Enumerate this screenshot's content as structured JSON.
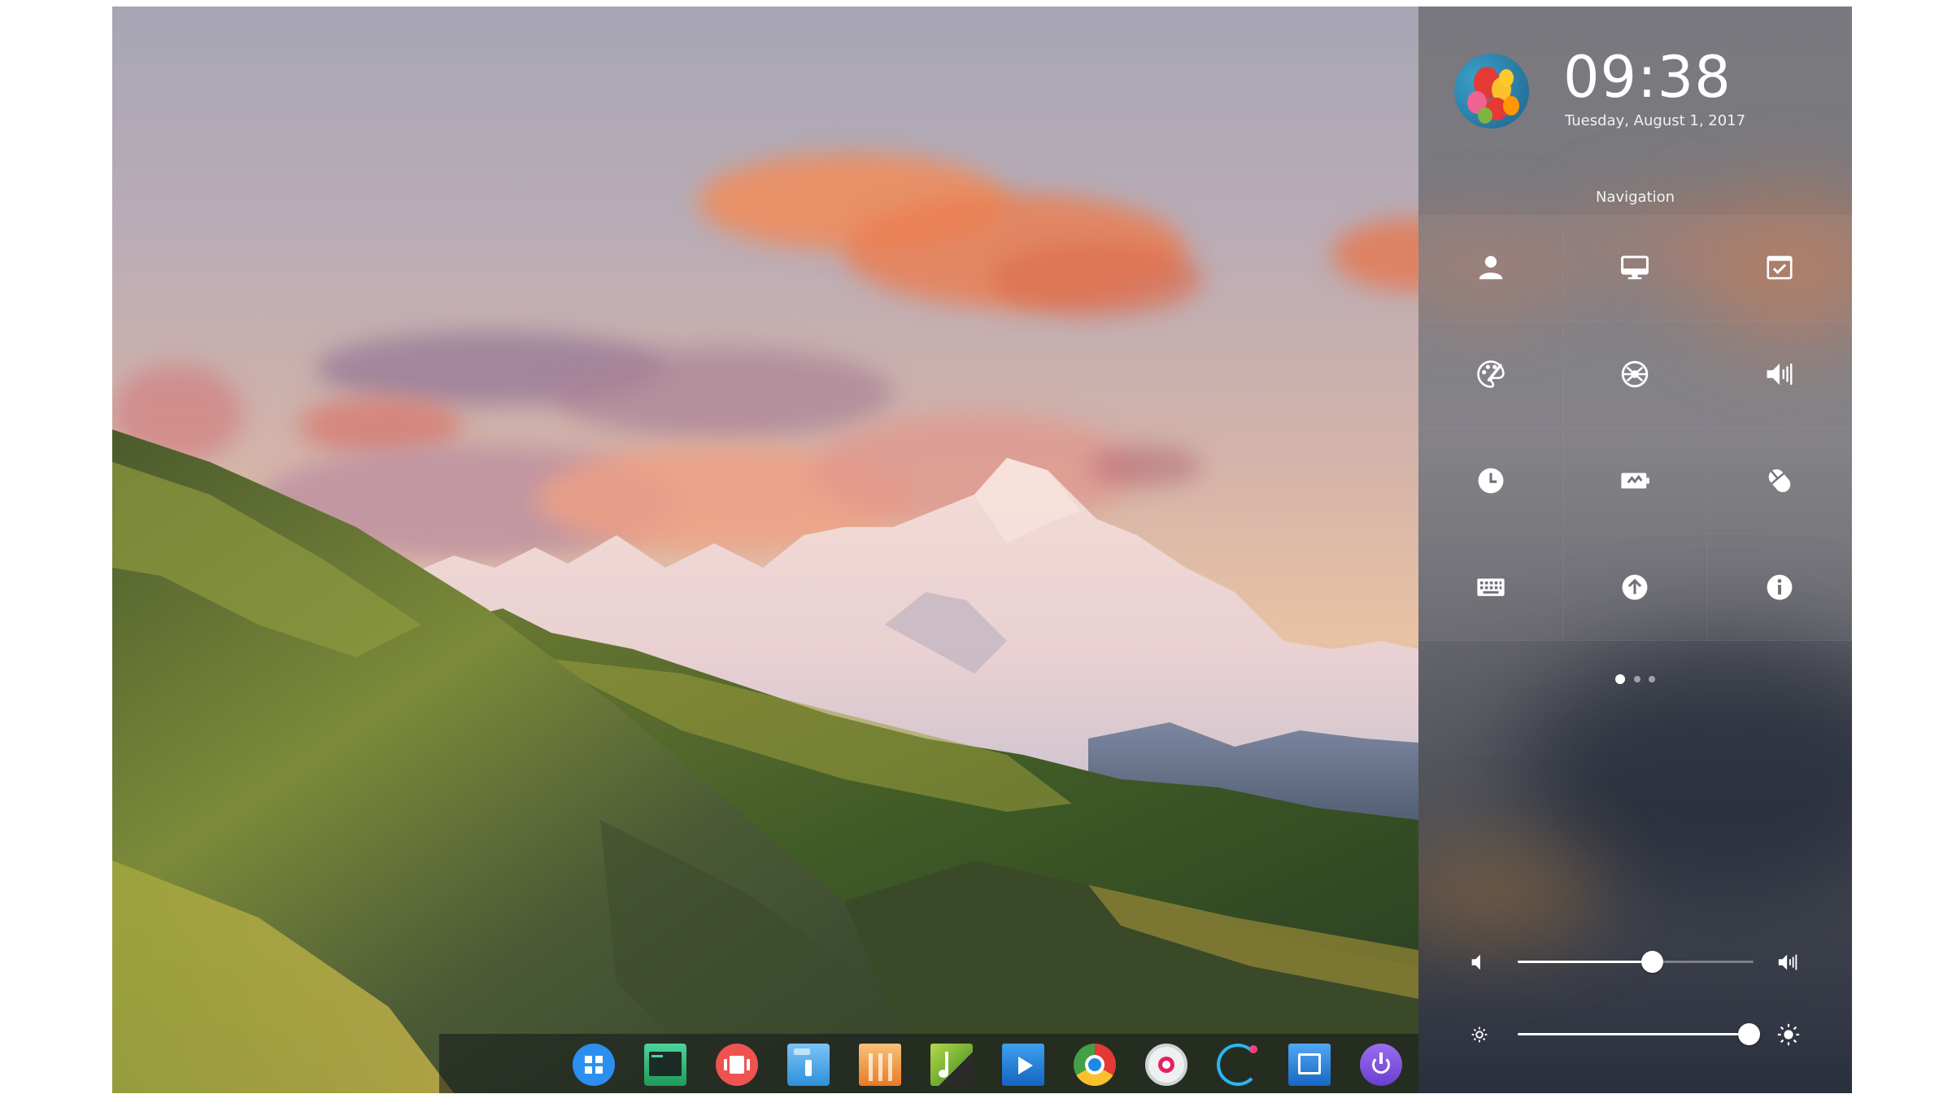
{
  "clock": {
    "time": "09:38",
    "date": "Tuesday, August 1, 2017"
  },
  "control_center": {
    "title": "Navigation",
    "tiles": [
      {
        "icon": "account-icon"
      },
      {
        "icon": "display-icon"
      },
      {
        "icon": "default-apps-icon"
      },
      {
        "icon": "personalization-icon"
      },
      {
        "icon": "network-icon"
      },
      {
        "icon": "sound-icon"
      },
      {
        "icon": "time-date-icon"
      },
      {
        "icon": "power-management-icon"
      },
      {
        "icon": "mouse-icon"
      },
      {
        "icon": "keyboard-icon"
      },
      {
        "icon": "update-icon"
      },
      {
        "icon": "system-info-icon"
      }
    ],
    "pager": {
      "pages": 3,
      "current": 1
    },
    "volume": {
      "level": 0.57
    },
    "brightness": {
      "level": 0.98
    }
  },
  "dock": {
    "apps": [
      {
        "name": "launcher-icon",
        "color": "#2b8ff0"
      },
      {
        "name": "terminal-icon",
        "color": "#2fbf71"
      },
      {
        "name": "multitasking-icon",
        "color": "#ef5350"
      },
      {
        "name": "file-manager-icon",
        "color": "#43a7f5"
      },
      {
        "name": "app-store-icon",
        "color": "#f28a30"
      },
      {
        "name": "music-icon",
        "color": "#8bc34a"
      },
      {
        "name": "movie-icon",
        "color": "#1e88e5"
      },
      {
        "name": "chrome-icon",
        "color": "#e53935"
      },
      {
        "name": "control-center-icon",
        "color": "#e91e63"
      },
      {
        "name": "system-monitor-icon",
        "color": "#29b6f6"
      },
      {
        "name": "screenshot-icon",
        "color": "#1976d2"
      },
      {
        "name": "shutdown-icon",
        "color": "#7e57c2"
      },
      {
        "name": "trash-icon",
        "color": "#ff9800"
      },
      {
        "name": "clock-icon",
        "color": "#fbc02d"
      }
    ]
  }
}
